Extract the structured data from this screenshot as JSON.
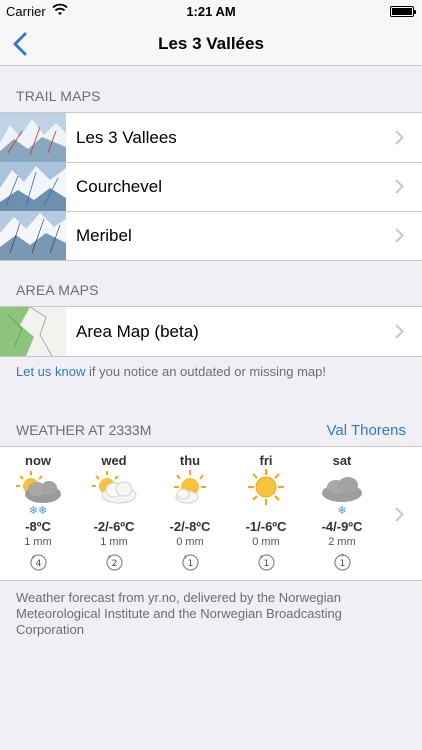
{
  "status_bar": {
    "carrier": "Carrier",
    "time": "1:21 AM"
  },
  "nav": {
    "title": "Les 3 Vallées"
  },
  "trail_maps": {
    "header": "TRAIL MAPS",
    "items": [
      {
        "label": "Les 3 Vallees"
      },
      {
        "label": "Courchevel"
      },
      {
        "label": "Meribel"
      }
    ]
  },
  "area_maps": {
    "header": "AREA MAPS",
    "items": [
      {
        "label": "Area Map (beta)"
      }
    ]
  },
  "info": {
    "link": "Let us know",
    "text": " if you notice an outdated or missing map!"
  },
  "weather": {
    "header": "WEATHER AT 2333M",
    "location": "Val Thorens",
    "days": [
      {
        "name": "now",
        "icon": "snow-cloud-sun-icon",
        "snow": "❄❄",
        "temp": "-8ºC",
        "precip": "1 mm",
        "wind": "4"
      },
      {
        "name": "wed",
        "icon": "partly-cloudy-icon",
        "snow": "",
        "temp": "-2/-6ºC",
        "precip": "1 mm",
        "wind": "2"
      },
      {
        "name": "thu",
        "icon": "sun-small-cloud-icon",
        "snow": "",
        "temp": "-2/-8ºC",
        "precip": "0 mm",
        "wind": "1"
      },
      {
        "name": "fri",
        "icon": "sun-icon",
        "snow": "",
        "temp": "-1/-6ºC",
        "precip": "0 mm",
        "wind": "1"
      },
      {
        "name": "sat",
        "icon": "snow-cloud-icon",
        "snow": "❄",
        "temp": "-4/-9ºC",
        "precip": "2 mm",
        "wind": "1"
      }
    ]
  },
  "footer": {
    "text": "Weather forecast from yr.no, delivered by the Norwegian Meteorological Institute and the Norwegian Broadcasting Corporation"
  },
  "colors": {
    "link": "#3478c6",
    "snow": "#4a9fd8",
    "sun": "#f5a623"
  }
}
